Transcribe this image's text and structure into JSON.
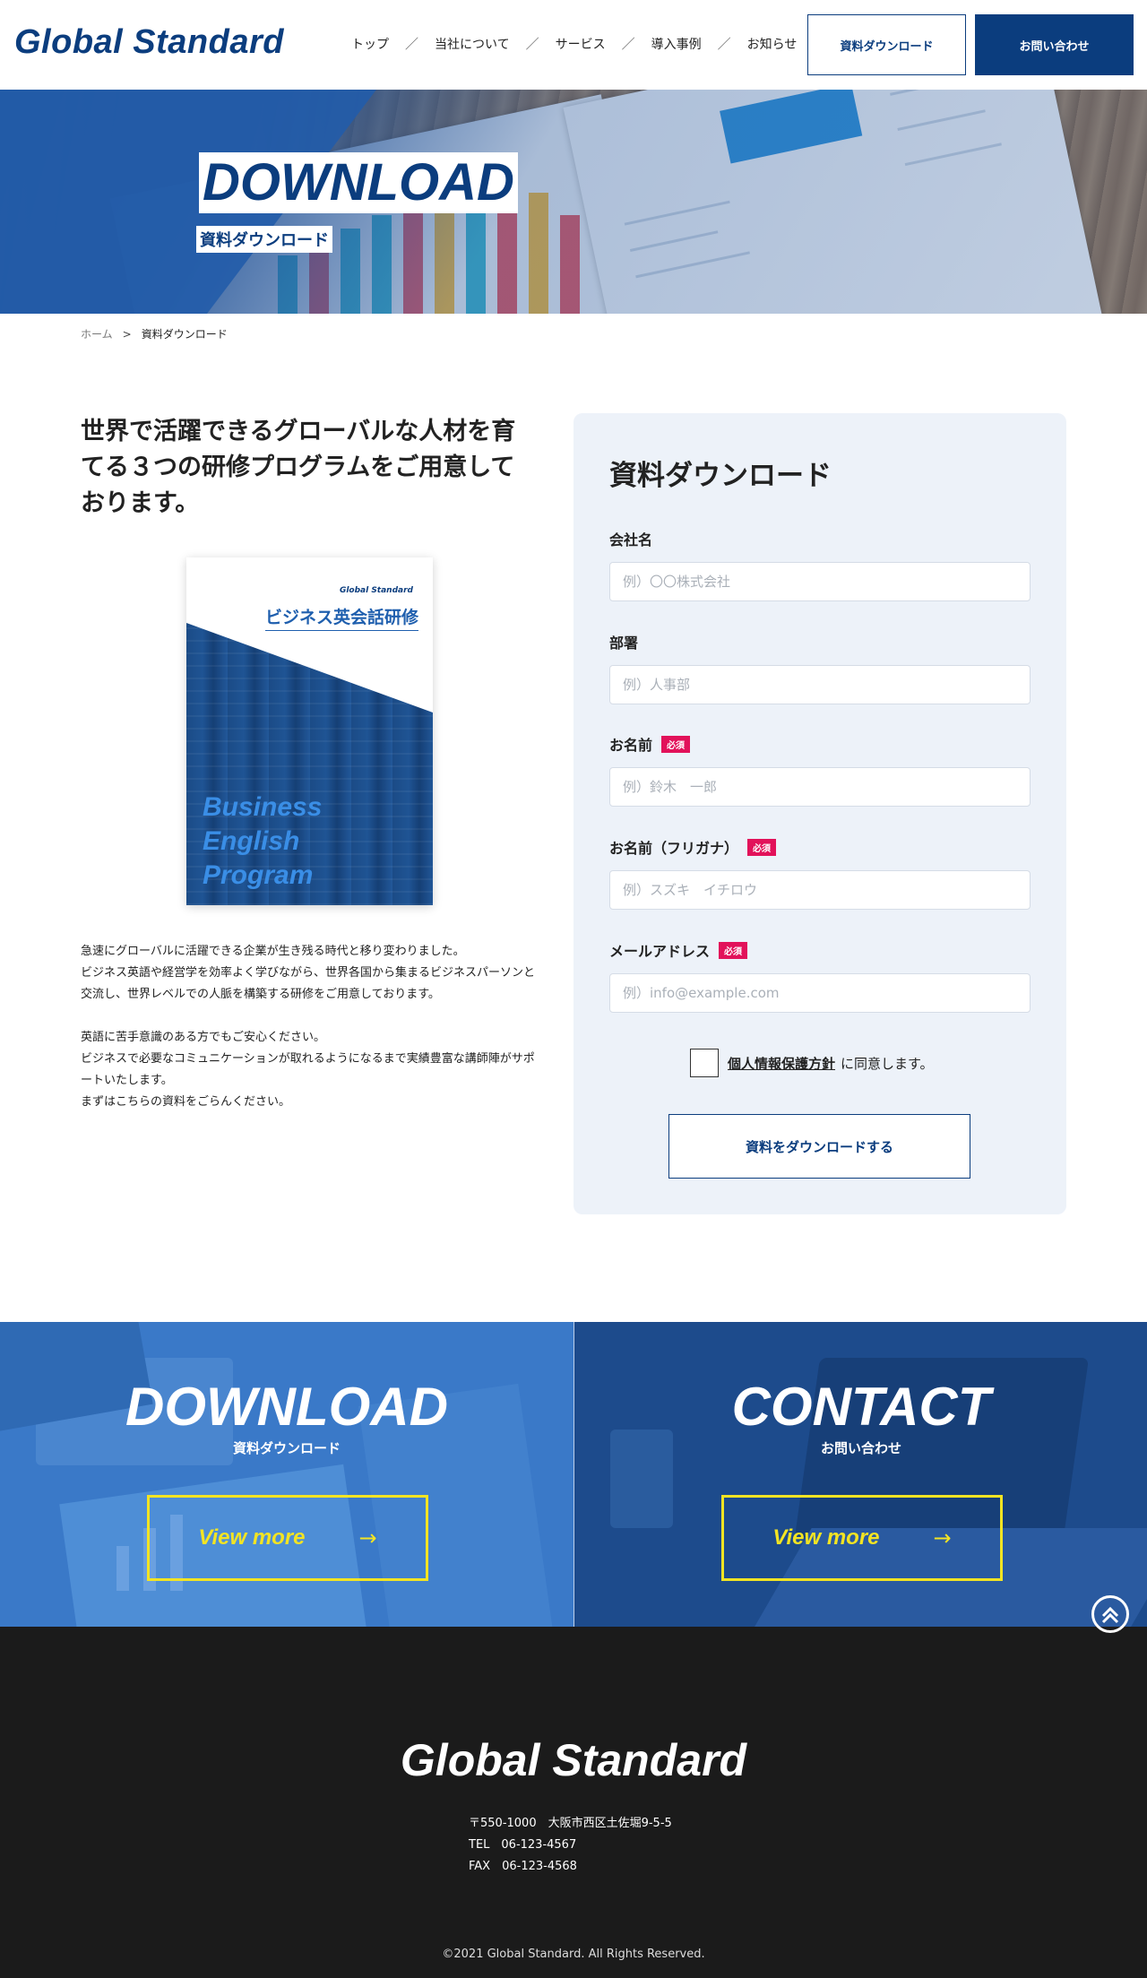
{
  "header": {
    "logo": "Global Standard",
    "nav": [
      {
        "label": "トップ"
      },
      {
        "label": "当社について"
      },
      {
        "label": "サービス"
      },
      {
        "label": "導入事例"
      },
      {
        "label": "お知らせ"
      }
    ],
    "nav_separator": "／",
    "download_button": "資料ダウンロード",
    "contact_button": "お問い合わせ"
  },
  "hero": {
    "title": "DOWNLOAD",
    "subtitle": "資料ダウンロード"
  },
  "breadcrumb": {
    "home": "ホーム",
    "separator": ">",
    "current": "資料ダウンロード"
  },
  "intro": {
    "heading": "世界で活躍できるグローバルな人材を育てる３つの研修プログラムをご用意しております。",
    "book": {
      "brand": "Global Standard",
      "title": "ビジネス英会話研修",
      "english_title": "Business English Program"
    },
    "paragraphs": [
      "急速にグローバルに活躍できる企業が生き残る時代と移り変わりました。\nビジネス英語や経営学を効率よく学びながら、世界各国から集まるビジネスパーソンと交流し、世界レベルでの人脈を構築する研修をご用意しております。",
      "英語に苦手意識のある方でもご安心ください。\nビジネスで必要なコミュニケーションが取れるようになるまで実績豊富な講師陣がサポートいたします。\nまずはこちらの資料をごらんください。"
    ]
  },
  "form": {
    "title": "資料ダウンロード",
    "required_badge": "必須",
    "fields": [
      {
        "label": "会社名",
        "placeholder": "例）〇〇株式会社",
        "value": ""
      },
      {
        "label": "部署",
        "placeholder": "例）人事部",
        "value": ""
      },
      {
        "label": "お名前",
        "placeholder": "例）鈴木　一郎",
        "value": ""
      },
      {
        "label": "お名前（フリガナ）",
        "placeholder": "例）スズキ　イチロウ",
        "value": ""
      },
      {
        "label": "メールアドレス",
        "placeholder": "例）info@example.com",
        "value": ""
      }
    ],
    "consent_link": "個人情報保護方針",
    "consent_text": "に同意します。",
    "submit": "資料をダウンロードする"
  },
  "cta": {
    "download": {
      "title": "DOWNLOAD",
      "subtitle": "資料ダウンロード",
      "button": "View more"
    },
    "contact": {
      "title": "CONTACT",
      "subtitle": "お問い合わせ",
      "button": "View more"
    },
    "arrow": "→"
  },
  "footer": {
    "logo": "Global Standard",
    "address": "〒550-1000　大阪市西区土佐堀9-5-5",
    "tel": "TEL　06-123-4567",
    "fax": "FAX　06-123-4568",
    "copyright": "©2021 Global Standard. All Rights Reserved."
  },
  "colors": {
    "brand_navy": "#0b3d7e",
    "required_pink": "#e2125a",
    "cta_yellow": "#f3e423",
    "form_bg": "#edf2f9",
    "footer_bg": "#1b1b1b"
  }
}
